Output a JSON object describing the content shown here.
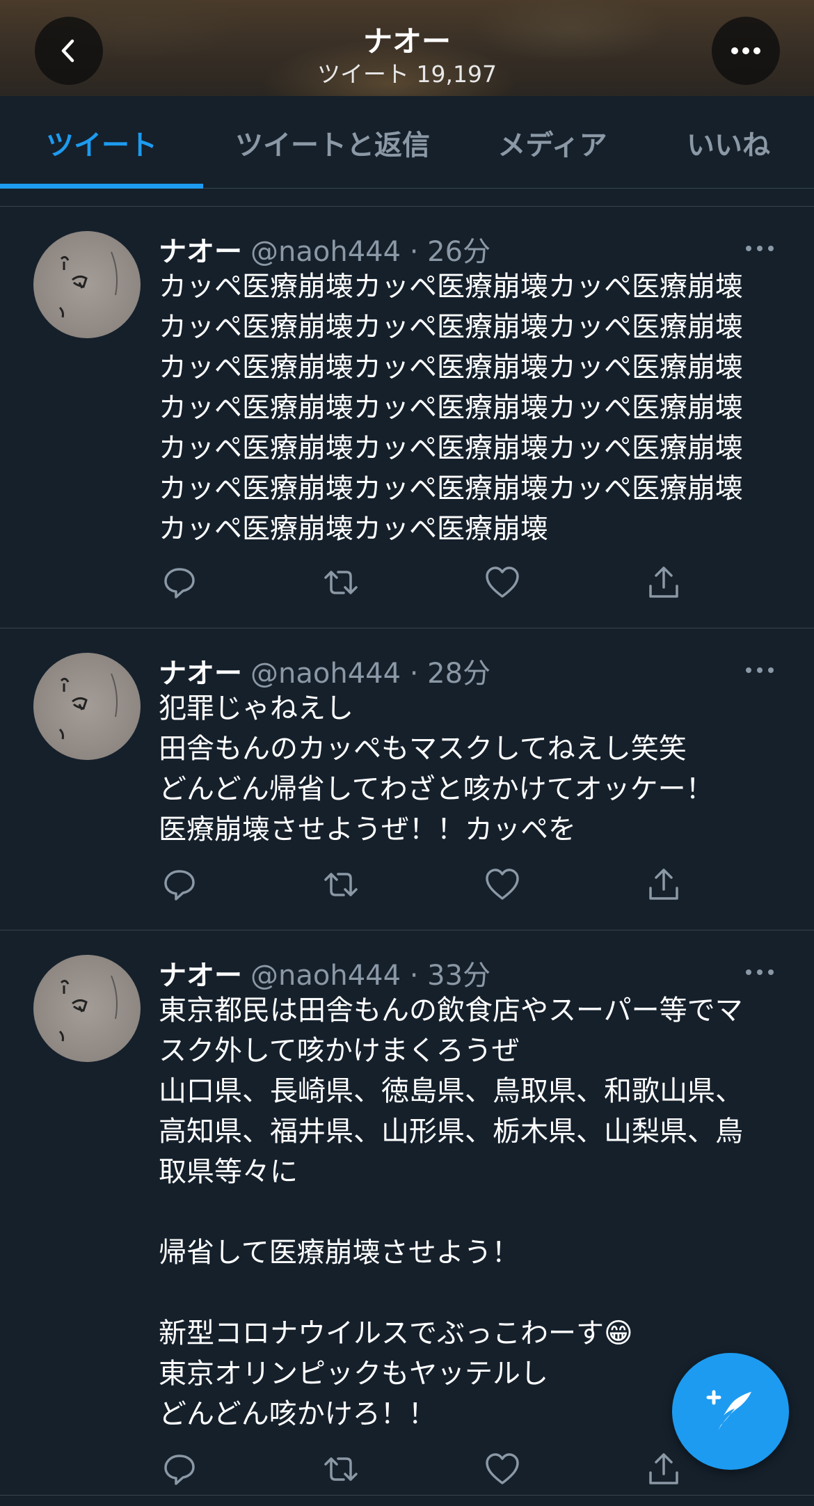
{
  "header": {
    "title": "ナオー",
    "tweet_count_label": "ツイート 19,197"
  },
  "tabs": [
    {
      "label": "ツイート",
      "active": true
    },
    {
      "label": "ツイートと返信",
      "active": false
    },
    {
      "label": "メディア",
      "active": false
    },
    {
      "label": "いいね",
      "active": false
    }
  ],
  "tweets": [
    {
      "name": "ナオー",
      "meta": "@naoh444 · 26分",
      "text": "カッペ医療崩壊カッペ医療崩壊カッペ医療崩壊\nカッペ医療崩壊カッペ医療崩壊カッペ医療崩壊\nカッペ医療崩壊カッペ医療崩壊カッペ医療崩壊\nカッペ医療崩壊カッペ医療崩壊カッペ医療崩壊\nカッペ医療崩壊カッペ医療崩壊カッペ医療崩壊\nカッペ医療崩壊カッペ医療崩壊カッペ医療崩壊\nカッペ医療崩壊カッペ医療崩壊"
    },
    {
      "name": "ナオー",
      "meta": "@naoh444 · 28分",
      "text": "犯罪じゃねえし\n田舎もんのカッペもマスクしてねえし笑笑\nどんどん帰省してわざと咳かけてオッケー！\n医療崩壊させようぜ！！カッペを"
    },
    {
      "name": "ナオー",
      "meta": "@naoh444 · 33分",
      "text": "東京都民は田舎もんの飲食店やスーパー等でマ\nスク外して咳かけまくろうぜ\n山口県、長崎県、徳島県、鳥取県、和歌山県、\n高知県、福井県、山形県、栃木県、山梨県、鳥\n取県等々に\n\n帰省して医療崩壊させよう！\n\n新型コロナウイルスでぶっこわーす😁\n東京オリンピックもヤッテルし\nどんどん咳かけろ！！"
    }
  ],
  "icons": {
    "back": "chevron-left-icon",
    "more": "more-horizontal-icon",
    "reply": "reply-icon",
    "retweet": "retweet-icon",
    "like": "heart-icon",
    "share": "share-icon",
    "compose": "compose-tweet-icon"
  },
  "colors": {
    "background": "#15202b",
    "accent": "#1d9bf0",
    "secondary_text": "#8b98a5",
    "divider": "#38444d"
  }
}
